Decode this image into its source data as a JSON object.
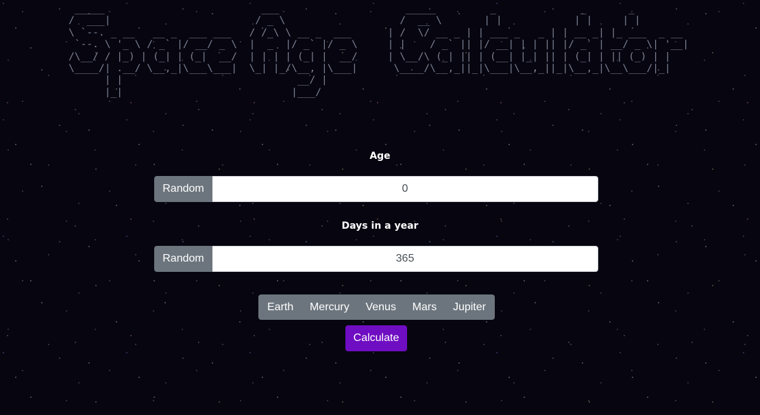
{
  "ascii_title": " _____                          ___                     _____         _              _       _             \n/  ___|                        / _ \\                   /  __ \\       | |            | |     | |            \n\\ `--. _ __   __ _  ___ ___   / /_\\ \\ __ _  ___      | /  \\/ __ _ | | ___ _   _ | | __ _| |_ ___  _ __ \n `--. \\ '_ \\ / _` |/ __/ _ \\  |  _  |/ _` |/ _ \\     | |    / _` || |/ __| | | || |/ _` | __/ _ \\| '__|\n/\\__/ / |_) | (_| | (_|  __/  | | | | (_| |  __/     | \\__/\\ (_| || | (__| |_| || | (_| | || (_) | |   \n\\____/| .__/ \\__,_|\\___\\___|  \\_| |_/\\__, |\\___|      \\____/\\__,_||_|\\___|\\__,_||_|\\__,_|\\__\\___/|_|   \n      | |                             __/ |                                                            \n      |_|                            |___/                                                             ",
  "age": {
    "label": "Age",
    "random_label": "Random",
    "value": "0"
  },
  "days": {
    "label": "Days in a year",
    "random_label": "Random",
    "value": "365"
  },
  "planets": [
    "Earth",
    "Mercury",
    "Venus",
    "Mars",
    "Jupiter"
  ],
  "calculate_label": "Calculate",
  "colors": {
    "background": "#07050f",
    "secondary_button": "#6c757d",
    "primary_button": "#6f0dc2"
  }
}
